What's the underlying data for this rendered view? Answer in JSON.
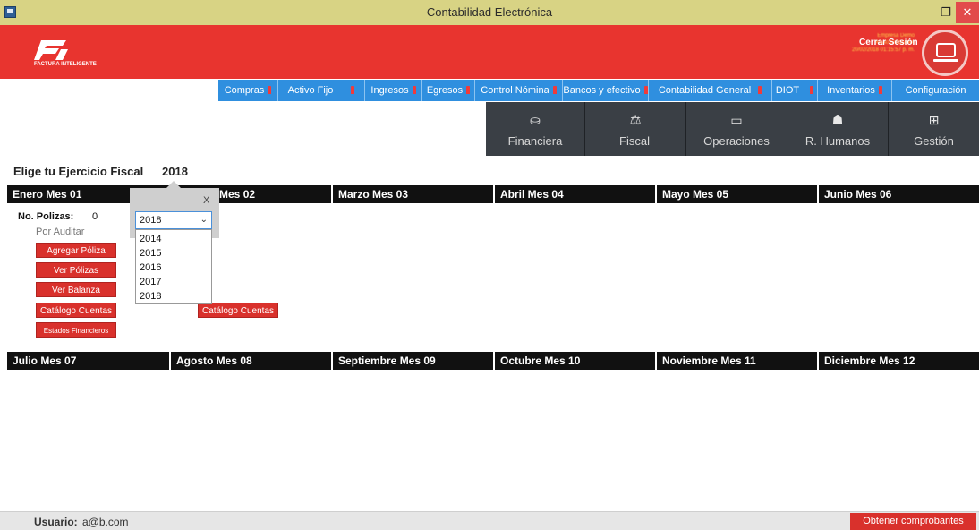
{
  "window": {
    "title": "Contabilidad Electrónica",
    "min": "—",
    "max": "❐",
    "close": "✕"
  },
  "header": {
    "logo_text": "FACTURA INTELIGENTE",
    "company_name": "Empresa Demo",
    "company_rfc": "AAA010101AAA",
    "datetime": "20/02/2018 01:15:57 p. m.",
    "logout_label": "Cerrar Sesión",
    "brand_color": "#e8342f"
  },
  "nav": {
    "items": [
      {
        "label": "Compras",
        "pin": true
      },
      {
        "label": "Activo Fijo",
        "pin": true
      },
      {
        "label": "Ingresos",
        "pin": true
      },
      {
        "label": "Egresos",
        "pin": true
      },
      {
        "label": "Control Nómina",
        "pin": true
      },
      {
        "label": "Bancos y efectivo",
        "pin": true
      },
      {
        "label": "Contabilidad General",
        "pin": true
      },
      {
        "label": "DIOT",
        "pin": true
      },
      {
        "label": "Inventarios",
        "pin": true
      },
      {
        "label": "Configuración",
        "pin": false
      }
    ]
  },
  "categories": [
    {
      "label": "Financiera",
      "icon": "coins-icon",
      "glyph": "⛀"
    },
    {
      "label": "Fiscal",
      "icon": "scale-icon",
      "glyph": "⚖"
    },
    {
      "label": "Operaciones",
      "icon": "monitor-icon",
      "glyph": "▭"
    },
    {
      "label": "R. Humanos",
      "icon": "person-icon",
      "glyph": "☗"
    },
    {
      "label": "Gestión",
      "icon": "org-chart-icon",
      "glyph": "⊞"
    }
  ],
  "fiscal": {
    "label": "Elige tu Ejercicio Fiscal",
    "year": "2018"
  },
  "months_row1": [
    "Enero Mes 01",
    "Febrero Mes 02",
    "Marzo Mes 03",
    "Abril Mes 04",
    "Mayo Mes 05",
    "Junio Mes 06"
  ],
  "months_row2": [
    "Julio Mes 07",
    "Agosto Mes 08",
    "Septiembre Mes 09",
    "Octubre Mes 10",
    "Noviembre Mes 11",
    "Diciembre Mes 12"
  ],
  "month_panel": {
    "polizas_label": "No. Polizas:",
    "polizas_count": "0",
    "por_auditar": "Por Auditar",
    "buttons": {
      "agregar": "Agregar Póliza",
      "ver_polizas": "Ver Pólizas",
      "ver_balanza": "Ver Balanza",
      "catalogo": "Catálogo Cuentas",
      "estados": "Estados Financieros",
      "catalogo2": "Catálogo Cuentas"
    }
  },
  "year_popup": {
    "close": "X",
    "selected": "2018",
    "options": [
      "2014",
      "2015",
      "2016",
      "2017",
      "2018"
    ]
  },
  "statusbar": {
    "user_label": "Usuario:",
    "user_value": "a@b.com",
    "fetch_button": "Obtener comprobantes"
  }
}
